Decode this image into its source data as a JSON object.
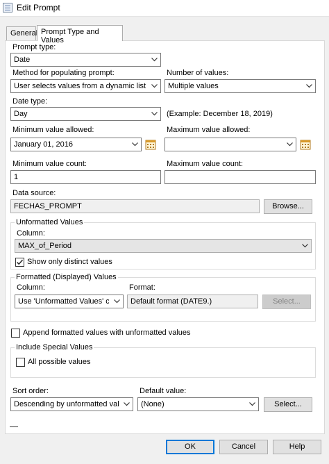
{
  "window": {
    "title": "Edit Prompt",
    "app_icon": "form-icon"
  },
  "tabs": [
    {
      "label": "General",
      "active": false
    },
    {
      "label": "Prompt Type and Values",
      "active": true
    }
  ],
  "prompt_type": {
    "label": "Prompt type:",
    "value": "Date"
  },
  "method": {
    "label": "Method for populating prompt:",
    "value": "User selects values from a dynamic list"
  },
  "number_of_values": {
    "label": "Number of values:",
    "value": "Multiple values"
  },
  "date_type": {
    "label": "Date type:",
    "value": "Day",
    "example": "(Example: December 18, 2019)"
  },
  "min_value": {
    "label": "Minimum value allowed:",
    "value": "January 01, 2016"
  },
  "max_value": {
    "label": "Maximum value allowed:",
    "value": ""
  },
  "min_count": {
    "label": "Minimum value count:",
    "value": "1"
  },
  "max_count": {
    "label": "Maximum value count:",
    "value": ""
  },
  "data_source": {
    "label": "Data source:",
    "value": "FECHAS_PROMPT",
    "browse_label": "Browse..."
  },
  "unformatted": {
    "title": "Unformatted Values",
    "column_label": "Column:",
    "column_value": "MAX_of_Period",
    "distinct_label": "Show only distinct values",
    "distinct_checked": true
  },
  "formatted": {
    "title": "Formatted (Displayed) Values",
    "column_label": "Column:",
    "column_value": "Use 'Unformatted Values' colu",
    "format_label": "Format:",
    "format_value": "Default format (DATE9.)",
    "select_label": "Select..."
  },
  "append": {
    "label": "Append formatted values with unformatted values",
    "checked": false
  },
  "special": {
    "title": "Include Special Values",
    "all_label": "All possible values",
    "all_checked": false
  },
  "sort_order": {
    "label": "Sort order:",
    "value": "Descending by unformatted value"
  },
  "default_value": {
    "label": "Default value:",
    "value": "(None)",
    "select_label": "Select..."
  },
  "footer": {
    "ok_label": "OK",
    "cancel_label": "Cancel",
    "help_label": "Help"
  },
  "colors": {
    "focus_blue": "#0078d7",
    "disabled_fill": "#e5e5e5"
  }
}
